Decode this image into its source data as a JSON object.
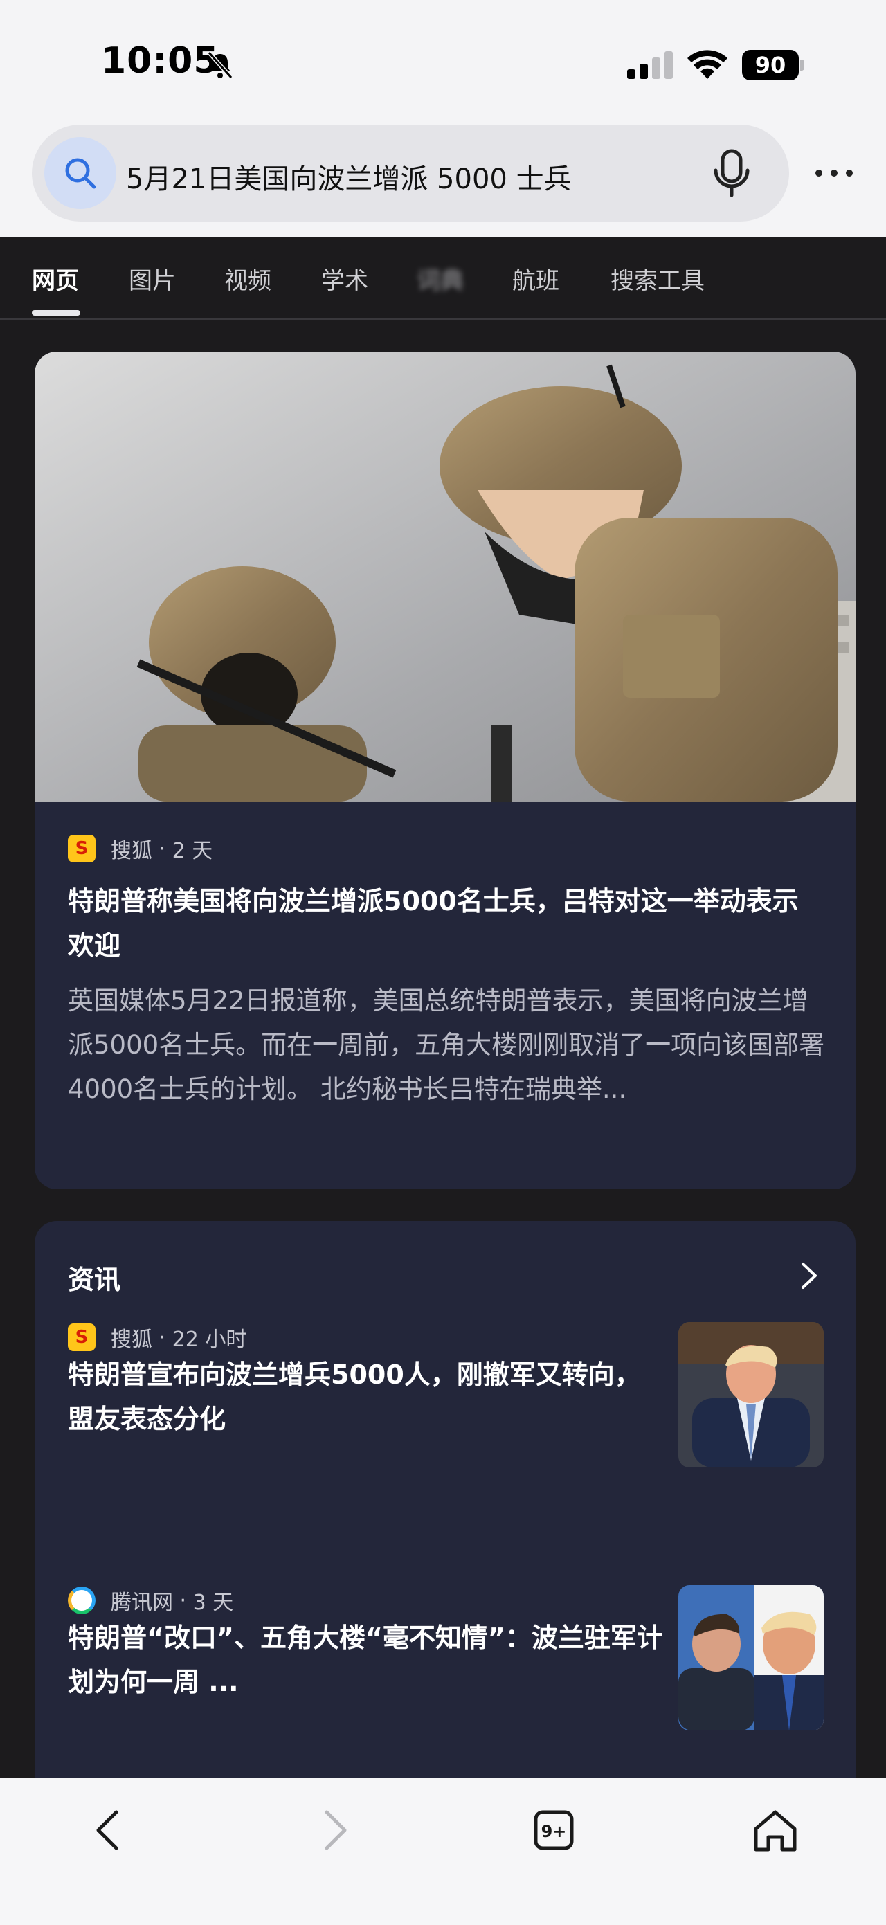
{
  "status_bar": {
    "time": "10:05",
    "battery": "90"
  },
  "search": {
    "query": "5月21日美国向波兰增派 5000 士兵"
  },
  "tabs": [
    {
      "label": "网页",
      "active": true
    },
    {
      "label": "图片"
    },
    {
      "label": "视频"
    },
    {
      "label": "学术"
    },
    {
      "label": "词典"
    },
    {
      "label": "航班"
    },
    {
      "label": "搜索工具"
    }
  ],
  "hero": {
    "source": "搜狐",
    "time": "2 天",
    "title": "特朗普称美国将向波兰增派5000名士兵，吕特对这一举动表示欢迎",
    "snippet": "英国媒体5月22日报道称，美国总统特朗普表示，美国将向波兰增派5000名士兵。而在一周前，五角大楼刚刚取消了一项向该国部署4000名士兵的计划。 北约秘书长吕特在瑞典举..."
  },
  "news": {
    "header": "资讯",
    "items": [
      {
        "source": "搜狐",
        "time": "22 小时",
        "title": "特朗普宣布向波兰增兵5000人，刚撤军又转向，盟友表态分化"
      },
      {
        "source": "腾讯网",
        "time": "3 天",
        "title": "特朗普“改口”、五角大楼“毫不知情”：波兰驻军计划为何一周 ..."
      }
    ]
  },
  "toolbar": {
    "tab_count": "9+"
  },
  "colors": {
    "page_bg": "#1c1b1d",
    "card_bg": "#23263a",
    "header_bg": "#f4f4f6",
    "accent": "#2f6fe0"
  }
}
